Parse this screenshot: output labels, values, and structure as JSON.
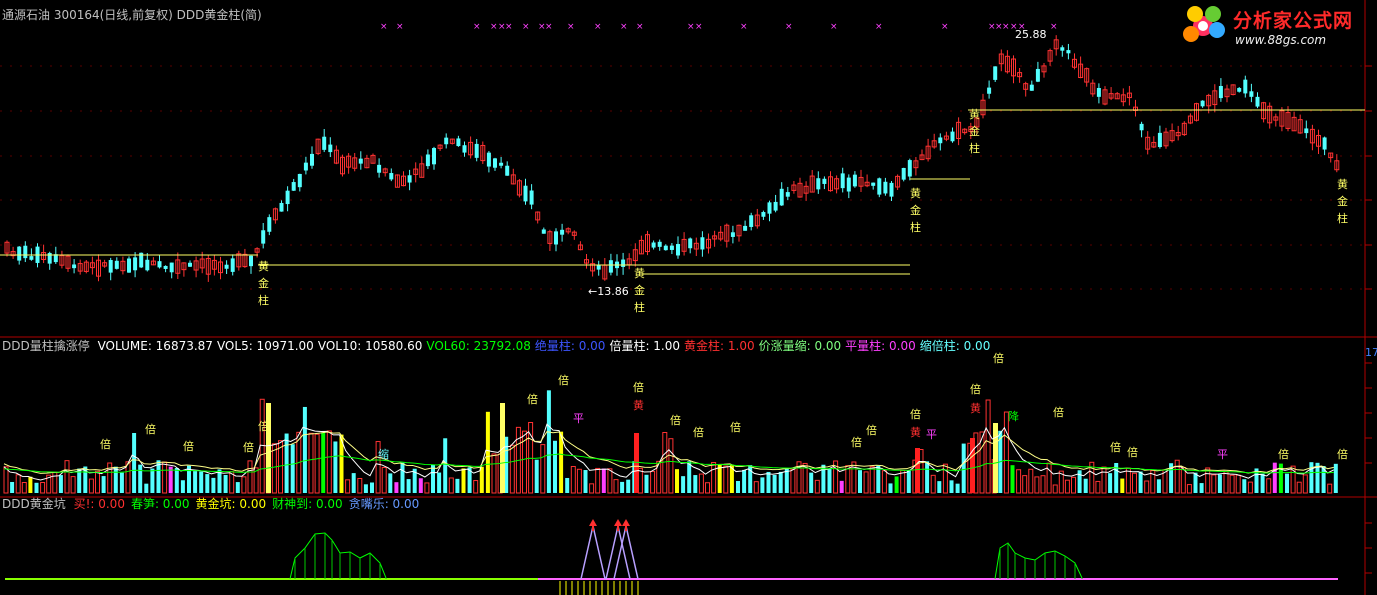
{
  "window": {
    "title": "通源石油 300164(日线,前复权) DDD黄金柱(简)"
  },
  "logo": {
    "title": "分析家公式网",
    "url": "www.88gs.com"
  },
  "main_chart": {
    "high_label": "25.88",
    "low_label": "←13.86",
    "gold_label": [
      "黄",
      "金",
      "柱"
    ]
  },
  "volume_panel": {
    "title": "DDD量柱擒涨停",
    "items": [
      {
        "label": "VOLUME: 16873.87",
        "color": "#ffffff"
      },
      {
        "label": "VOL5: 10971.00",
        "color": "#ffffff"
      },
      {
        "label": "VOL10: 10580.60",
        "color": "#ffffff"
      },
      {
        "label": "VOL60: 23792.08",
        "color": "#00ff00"
      },
      {
        "label": "绝量柱: 0.00",
        "color": "#3d55ff"
      },
      {
        "label": "倍量柱: 1.00",
        "color": "#ffffff"
      },
      {
        "label": "黄金柱: 1.00",
        "color": "#ff3030"
      },
      {
        "label": "价涨量缩: 0.00",
        "color": "#80ff80"
      },
      {
        "label": "平量柱: 0.00",
        "color": "#ff40ff"
      },
      {
        "label": "缩倍柱: 0.00",
        "color": "#66ffff"
      }
    ],
    "badge": "17",
    "annotations": {
      "bei": "倍",
      "huang": "黄",
      "ping": "平",
      "suo": "缩",
      "jiang": "降"
    }
  },
  "gold_pit_panel": {
    "title": "DDD黄金坑",
    "items": [
      {
        "label": "买!: 0.00",
        "color": "#ff3030"
      },
      {
        "label": "春笋: 0.00",
        "color": "#00ff00"
      },
      {
        "label": "黄金坑: 0.00",
        "color": "#ffff00"
      },
      {
        "label": "财神到: 0.00",
        "color": "#00ff00"
      },
      {
        "label": "贪嘴乐: 0.00",
        "color": "#6699ff"
      }
    ]
  },
  "colors": {
    "up": "#ff3232",
    "down": "#54ffff",
    "axis": "#b00000",
    "gold_line": "#ffff66",
    "text": "#c0c0c0"
  }
}
